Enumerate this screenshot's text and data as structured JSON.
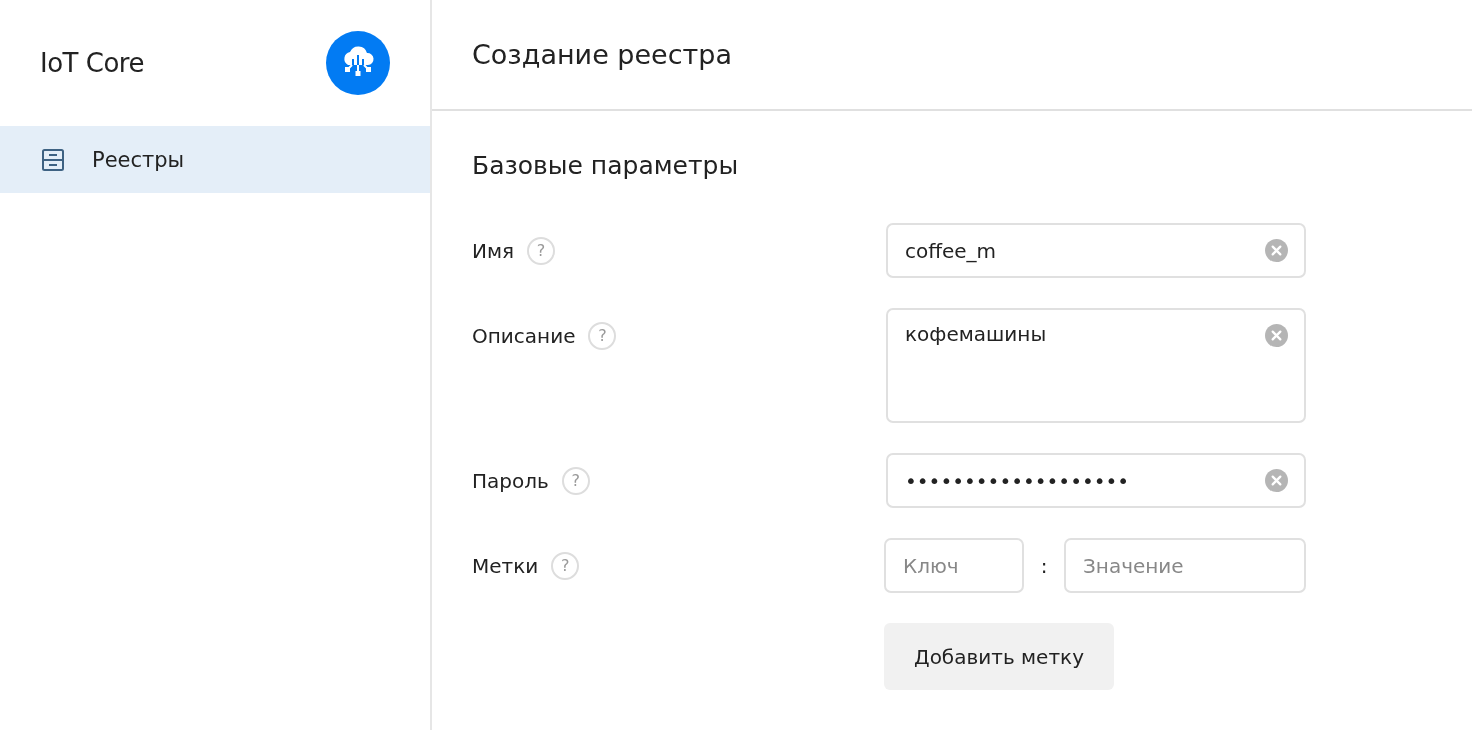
{
  "sidebar": {
    "title": "IoT Core",
    "items": [
      {
        "label": "Реестры",
        "selected": true
      }
    ]
  },
  "page": {
    "title": "Создание реестра"
  },
  "section": {
    "title": "Базовые параметры",
    "fields": [
      {
        "kind": "text",
        "label": "Имя",
        "help": "?",
        "value": "coffee_m"
      },
      {
        "kind": "textarea",
        "label": "Описание",
        "help": "?",
        "value": "кофемашины"
      },
      {
        "kind": "password",
        "label": "Пароль",
        "help": "?",
        "value": "•••••••••••••••••••"
      },
      {
        "kind": "tags",
        "label": "Метки",
        "help": "?",
        "key_placeholder": "Ключ",
        "separator": ":",
        "value_placeholder": "Значение"
      }
    ],
    "add_button": "Добавить метку"
  }
}
